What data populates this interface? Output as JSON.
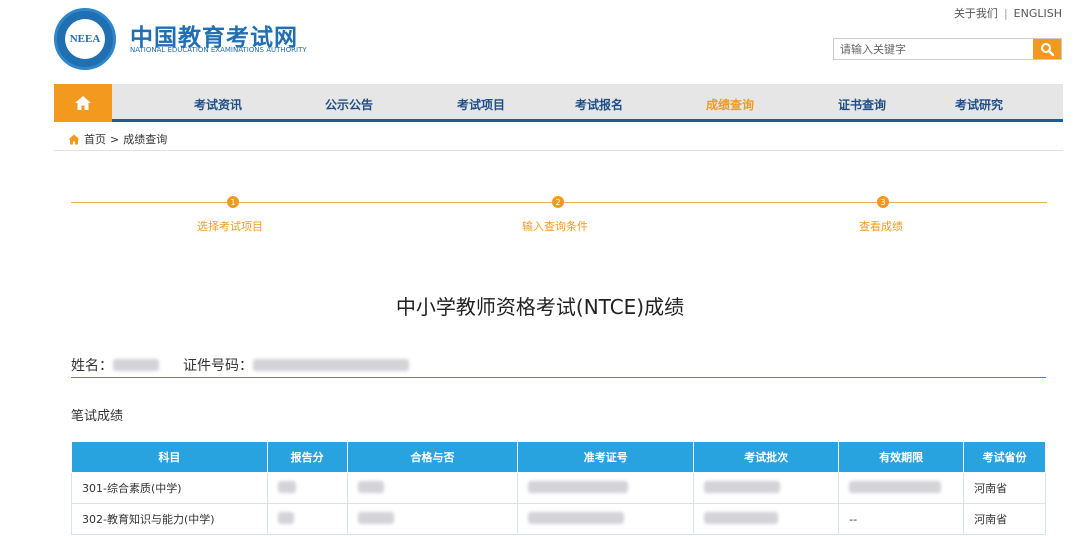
{
  "header": {
    "logo_text": "NEEA",
    "site_title": "中国教育考试网",
    "site_subtitle": "NATIONAL EDUCATION EXAMINATIONS AUTHORITY",
    "top_links": [
      "关于我们",
      "ENGLISH"
    ],
    "top_sep": "|",
    "search_placeholder": "请输入关键字"
  },
  "nav": {
    "items": [
      "考试资讯",
      "公示公告",
      "考试项目",
      "考试报名",
      "成绩查询",
      "证书查询",
      "考试研究"
    ],
    "active": "成绩查询"
  },
  "breadcrumb": {
    "home": "首页",
    "sep": ">",
    "current": "成绩查询"
  },
  "steps": [
    {
      "num": "1",
      "label": "选择考试项目"
    },
    {
      "num": "2",
      "label": "输入查询条件"
    },
    {
      "num": "3",
      "label": "查看成绩"
    }
  ],
  "result": {
    "title": "中小学教师资格考试(NTCE)成绩",
    "name_label": "姓名：",
    "id_label": "证件号码：",
    "section_title": "笔试成绩"
  },
  "table": {
    "headers": [
      "科目",
      "报告分",
      "合格与否",
      "准考证号",
      "考试批次",
      "有效期限",
      "考试省份"
    ],
    "rows": [
      {
        "subject": "301-综合素质(中学)",
        "province": "河南省"
      },
      {
        "subject": "302-教育知识与能力(中学)",
        "validity": "--",
        "province": "河南省"
      }
    ]
  },
  "colors": {
    "primary": "#1f6fb2",
    "accent": "#f39a1e",
    "table_header": "#29a3e0"
  }
}
